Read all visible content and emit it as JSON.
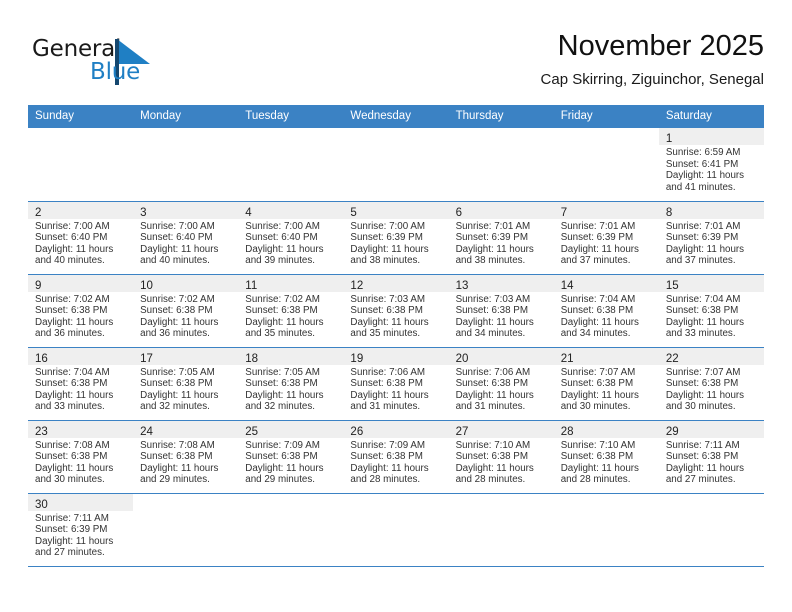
{
  "brand": {
    "name_part1": "General",
    "name_part2": "Blue",
    "accent_color": "#1f7fc4",
    "dark_color": "#15476f"
  },
  "header": {
    "title": "November 2025",
    "subtitle": "Cap Skirring, Ziguinchor, Senegal"
  },
  "theme": {
    "header_bg": "#3b82c4",
    "daynum_bg": "#efefef",
    "grid_line": "#3b82c4"
  },
  "weekdays": [
    "Sunday",
    "Monday",
    "Tuesday",
    "Wednesday",
    "Thursday",
    "Friday",
    "Saturday"
  ],
  "weeks": [
    [
      {
        "day": "",
        "sunrise": "",
        "sunset": "",
        "daylight1": "",
        "daylight2": ""
      },
      {
        "day": "",
        "sunrise": "",
        "sunset": "",
        "daylight1": "",
        "daylight2": ""
      },
      {
        "day": "",
        "sunrise": "",
        "sunset": "",
        "daylight1": "",
        "daylight2": ""
      },
      {
        "day": "",
        "sunrise": "",
        "sunset": "",
        "daylight1": "",
        "daylight2": ""
      },
      {
        "day": "",
        "sunrise": "",
        "sunset": "",
        "daylight1": "",
        "daylight2": ""
      },
      {
        "day": "",
        "sunrise": "",
        "sunset": "",
        "daylight1": "",
        "daylight2": ""
      },
      {
        "day": "1",
        "sunrise": "Sunrise: 6:59 AM",
        "sunset": "Sunset: 6:41 PM",
        "daylight1": "Daylight: 11 hours",
        "daylight2": "and 41 minutes."
      }
    ],
    [
      {
        "day": "2",
        "sunrise": "Sunrise: 7:00 AM",
        "sunset": "Sunset: 6:40 PM",
        "daylight1": "Daylight: 11 hours",
        "daylight2": "and 40 minutes."
      },
      {
        "day": "3",
        "sunrise": "Sunrise: 7:00 AM",
        "sunset": "Sunset: 6:40 PM",
        "daylight1": "Daylight: 11 hours",
        "daylight2": "and 40 minutes."
      },
      {
        "day": "4",
        "sunrise": "Sunrise: 7:00 AM",
        "sunset": "Sunset: 6:40 PM",
        "daylight1": "Daylight: 11 hours",
        "daylight2": "and 39 minutes."
      },
      {
        "day": "5",
        "sunrise": "Sunrise: 7:00 AM",
        "sunset": "Sunset: 6:39 PM",
        "daylight1": "Daylight: 11 hours",
        "daylight2": "and 38 minutes."
      },
      {
        "day": "6",
        "sunrise": "Sunrise: 7:01 AM",
        "sunset": "Sunset: 6:39 PM",
        "daylight1": "Daylight: 11 hours",
        "daylight2": "and 38 minutes."
      },
      {
        "day": "7",
        "sunrise": "Sunrise: 7:01 AM",
        "sunset": "Sunset: 6:39 PM",
        "daylight1": "Daylight: 11 hours",
        "daylight2": "and 37 minutes."
      },
      {
        "day": "8",
        "sunrise": "Sunrise: 7:01 AM",
        "sunset": "Sunset: 6:39 PM",
        "daylight1": "Daylight: 11 hours",
        "daylight2": "and 37 minutes."
      }
    ],
    [
      {
        "day": "9",
        "sunrise": "Sunrise: 7:02 AM",
        "sunset": "Sunset: 6:38 PM",
        "daylight1": "Daylight: 11 hours",
        "daylight2": "and 36 minutes."
      },
      {
        "day": "10",
        "sunrise": "Sunrise: 7:02 AM",
        "sunset": "Sunset: 6:38 PM",
        "daylight1": "Daylight: 11 hours",
        "daylight2": "and 36 minutes."
      },
      {
        "day": "11",
        "sunrise": "Sunrise: 7:02 AM",
        "sunset": "Sunset: 6:38 PM",
        "daylight1": "Daylight: 11 hours",
        "daylight2": "and 35 minutes."
      },
      {
        "day": "12",
        "sunrise": "Sunrise: 7:03 AM",
        "sunset": "Sunset: 6:38 PM",
        "daylight1": "Daylight: 11 hours",
        "daylight2": "and 35 minutes."
      },
      {
        "day": "13",
        "sunrise": "Sunrise: 7:03 AM",
        "sunset": "Sunset: 6:38 PM",
        "daylight1": "Daylight: 11 hours",
        "daylight2": "and 34 minutes."
      },
      {
        "day": "14",
        "sunrise": "Sunrise: 7:04 AM",
        "sunset": "Sunset: 6:38 PM",
        "daylight1": "Daylight: 11 hours",
        "daylight2": "and 34 minutes."
      },
      {
        "day": "15",
        "sunrise": "Sunrise: 7:04 AM",
        "sunset": "Sunset: 6:38 PM",
        "daylight1": "Daylight: 11 hours",
        "daylight2": "and 33 minutes."
      }
    ],
    [
      {
        "day": "16",
        "sunrise": "Sunrise: 7:04 AM",
        "sunset": "Sunset: 6:38 PM",
        "daylight1": "Daylight: 11 hours",
        "daylight2": "and 33 minutes."
      },
      {
        "day": "17",
        "sunrise": "Sunrise: 7:05 AM",
        "sunset": "Sunset: 6:38 PM",
        "daylight1": "Daylight: 11 hours",
        "daylight2": "and 32 minutes."
      },
      {
        "day": "18",
        "sunrise": "Sunrise: 7:05 AM",
        "sunset": "Sunset: 6:38 PM",
        "daylight1": "Daylight: 11 hours",
        "daylight2": "and 32 minutes."
      },
      {
        "day": "19",
        "sunrise": "Sunrise: 7:06 AM",
        "sunset": "Sunset: 6:38 PM",
        "daylight1": "Daylight: 11 hours",
        "daylight2": "and 31 minutes."
      },
      {
        "day": "20",
        "sunrise": "Sunrise: 7:06 AM",
        "sunset": "Sunset: 6:38 PM",
        "daylight1": "Daylight: 11 hours",
        "daylight2": "and 31 minutes."
      },
      {
        "day": "21",
        "sunrise": "Sunrise: 7:07 AM",
        "sunset": "Sunset: 6:38 PM",
        "daylight1": "Daylight: 11 hours",
        "daylight2": "and 30 minutes."
      },
      {
        "day": "22",
        "sunrise": "Sunrise: 7:07 AM",
        "sunset": "Sunset: 6:38 PM",
        "daylight1": "Daylight: 11 hours",
        "daylight2": "and 30 minutes."
      }
    ],
    [
      {
        "day": "23",
        "sunrise": "Sunrise: 7:08 AM",
        "sunset": "Sunset: 6:38 PM",
        "daylight1": "Daylight: 11 hours",
        "daylight2": "and 30 minutes."
      },
      {
        "day": "24",
        "sunrise": "Sunrise: 7:08 AM",
        "sunset": "Sunset: 6:38 PM",
        "daylight1": "Daylight: 11 hours",
        "daylight2": "and 29 minutes."
      },
      {
        "day": "25",
        "sunrise": "Sunrise: 7:09 AM",
        "sunset": "Sunset: 6:38 PM",
        "daylight1": "Daylight: 11 hours",
        "daylight2": "and 29 minutes."
      },
      {
        "day": "26",
        "sunrise": "Sunrise: 7:09 AM",
        "sunset": "Sunset: 6:38 PM",
        "daylight1": "Daylight: 11 hours",
        "daylight2": "and 28 minutes."
      },
      {
        "day": "27",
        "sunrise": "Sunrise: 7:10 AM",
        "sunset": "Sunset: 6:38 PM",
        "daylight1": "Daylight: 11 hours",
        "daylight2": "and 28 minutes."
      },
      {
        "day": "28",
        "sunrise": "Sunrise: 7:10 AM",
        "sunset": "Sunset: 6:38 PM",
        "daylight1": "Daylight: 11 hours",
        "daylight2": "and 28 minutes."
      },
      {
        "day": "29",
        "sunrise": "Sunrise: 7:11 AM",
        "sunset": "Sunset: 6:38 PM",
        "daylight1": "Daylight: 11 hours",
        "daylight2": "and 27 minutes."
      }
    ],
    [
      {
        "day": "30",
        "sunrise": "Sunrise: 7:11 AM",
        "sunset": "Sunset: 6:39 PM",
        "daylight1": "Daylight: 11 hours",
        "daylight2": "and 27 minutes."
      },
      {
        "day": "",
        "sunrise": "",
        "sunset": "",
        "daylight1": "",
        "daylight2": ""
      },
      {
        "day": "",
        "sunrise": "",
        "sunset": "",
        "daylight1": "",
        "daylight2": ""
      },
      {
        "day": "",
        "sunrise": "",
        "sunset": "",
        "daylight1": "",
        "daylight2": ""
      },
      {
        "day": "",
        "sunrise": "",
        "sunset": "",
        "daylight1": "",
        "daylight2": ""
      },
      {
        "day": "",
        "sunrise": "",
        "sunset": "",
        "daylight1": "",
        "daylight2": ""
      },
      {
        "day": "",
        "sunrise": "",
        "sunset": "",
        "daylight1": "",
        "daylight2": ""
      }
    ]
  ]
}
